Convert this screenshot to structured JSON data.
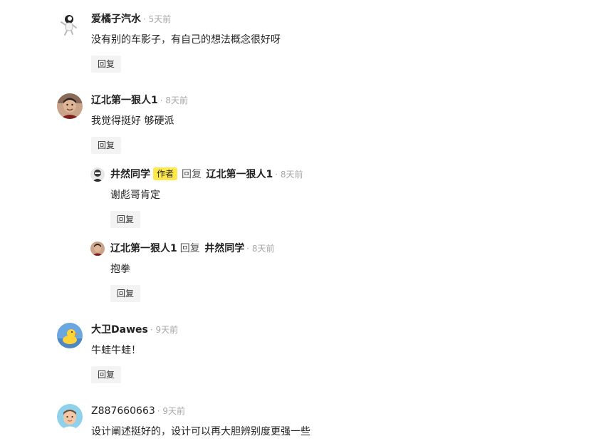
{
  "comments": [
    {
      "user": "爱橘子汽水",
      "time": "· 5天前",
      "text": "没有别的车影子，有自己的想法概念很好呀",
      "reply_label": "回复"
    },
    {
      "user": "辽北第一狠人1",
      "time": "· 8天前",
      "text": "我觉得挺好 够硬派",
      "reply_label": "回复",
      "replies": [
        {
          "user": "井然同学",
          "badge": "作者",
          "reply_word": "回复",
          "reply_to": "辽北第一狠人1",
          "time": "· 8天前",
          "text": "谢彪哥肯定",
          "reply_label": "回复"
        },
        {
          "user": "辽北第一狠人1",
          "reply_word": "回复",
          "reply_to": "井然同学",
          "time": "· 8天前",
          "text": "抱拳",
          "reply_label": "回复"
        }
      ]
    },
    {
      "user": "大卫Dawes",
      "time": "· 9天前",
      "text": "牛蛙牛蛙！",
      "reply_label": "回复"
    },
    {
      "user": "Z887660663",
      "time": "· 9天前",
      "text": "设计阐述挺好的，设计可以再大胆辨别度更强一些"
    }
  ],
  "icons": {
    "avatar_1": "astronaut-avatar-icon",
    "avatar_2": "man-portrait-avatar-icon",
    "avatar_3": "masked-figure-avatar-icon",
    "avatar_4": "rubber-duck-avatar-icon",
    "avatar_5": "cartoon-face-avatar-icon"
  },
  "colors": {
    "author_badge": "#ffe84a",
    "reply_button_bg": "#f3f3f3",
    "time_text": "#a7a7a7"
  }
}
